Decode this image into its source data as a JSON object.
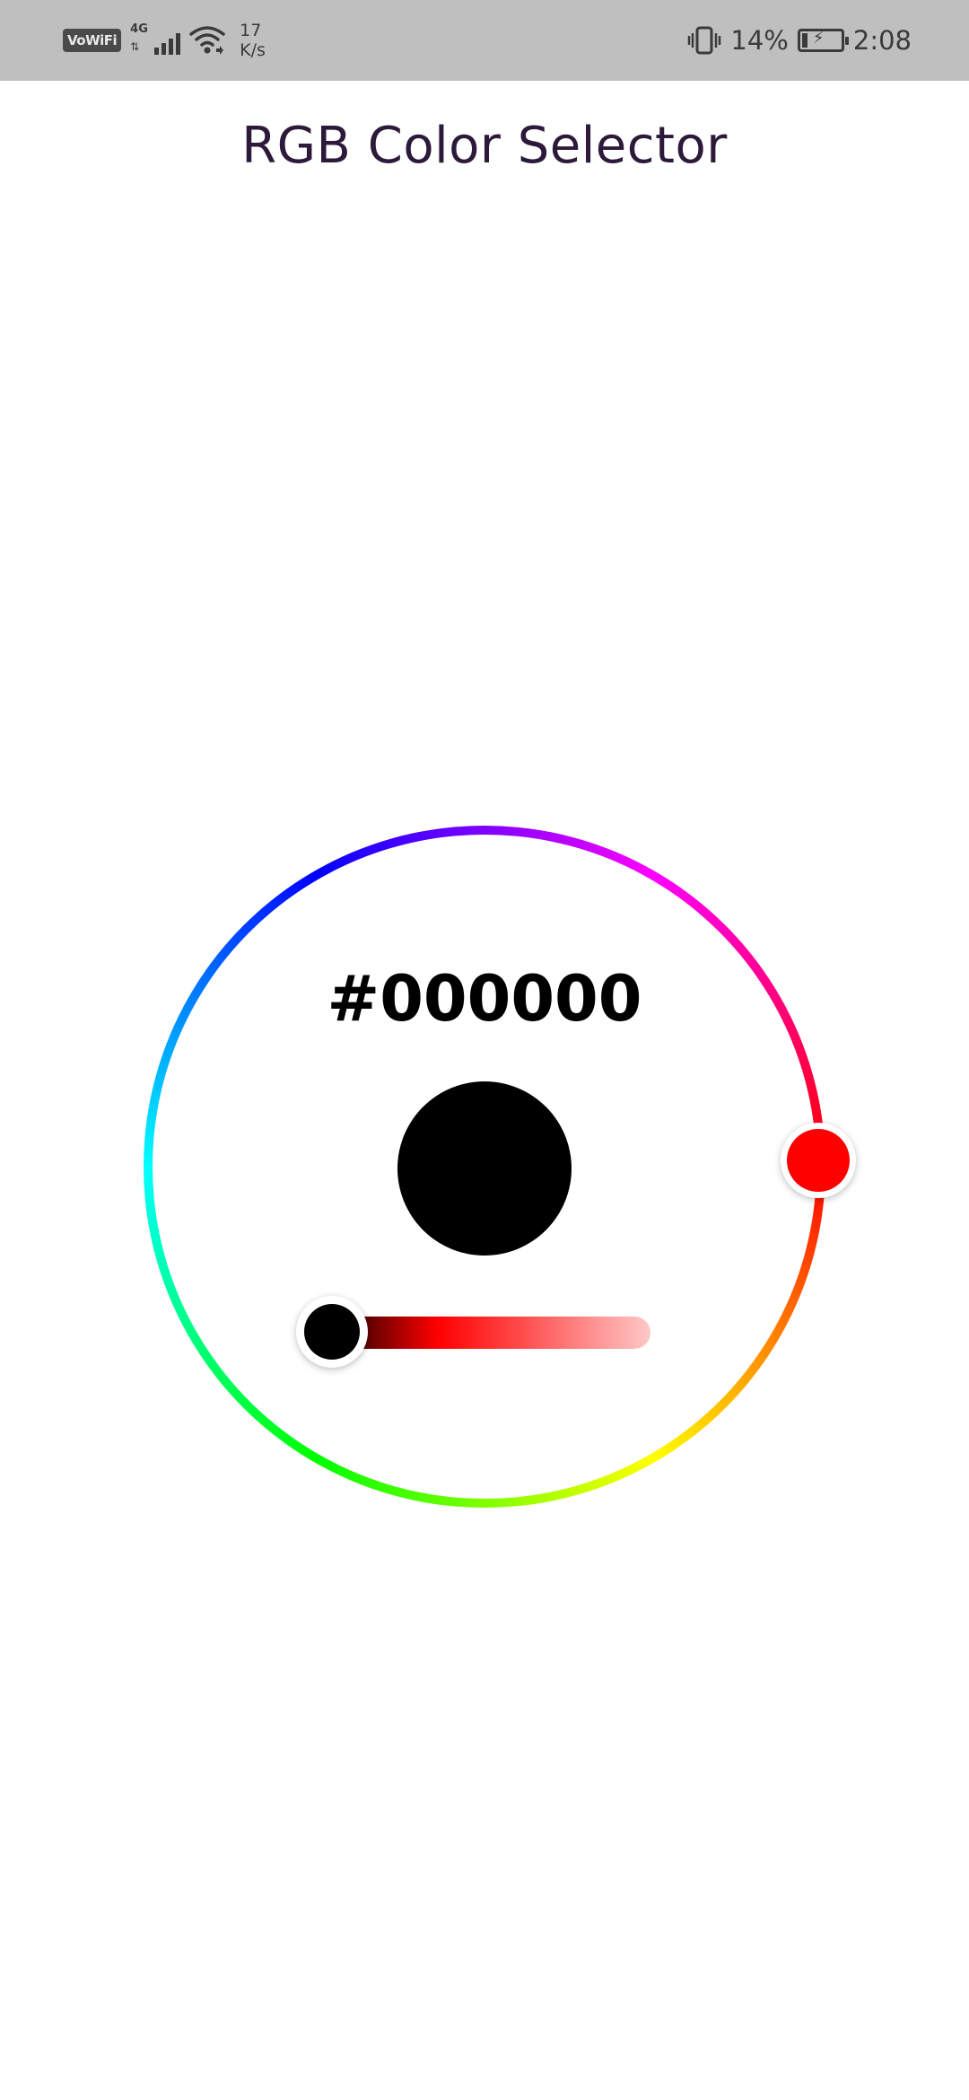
{
  "status_bar": {
    "vowifi_label": "VoWiFi",
    "network_type": "4G",
    "network_speed_value": "17",
    "network_speed_unit": "K/s",
    "battery_percent": "14%",
    "clock": "2:08",
    "icons": [
      "vowifi-icon",
      "cellular-signal-icon",
      "wifi-icon",
      "vibrate-icon",
      "battery-charging-icon"
    ]
  },
  "app": {
    "title": "RGB Color Selector"
  },
  "color_picker": {
    "hex_value": "#000000",
    "selected_color": "#000000",
    "hue_color": "#ff0000",
    "shade_level": 0
  },
  "colors": {
    "status_bar_bg": "#bfbfbf",
    "title_text": "#2d1a3a",
    "background": "#ffffff"
  }
}
